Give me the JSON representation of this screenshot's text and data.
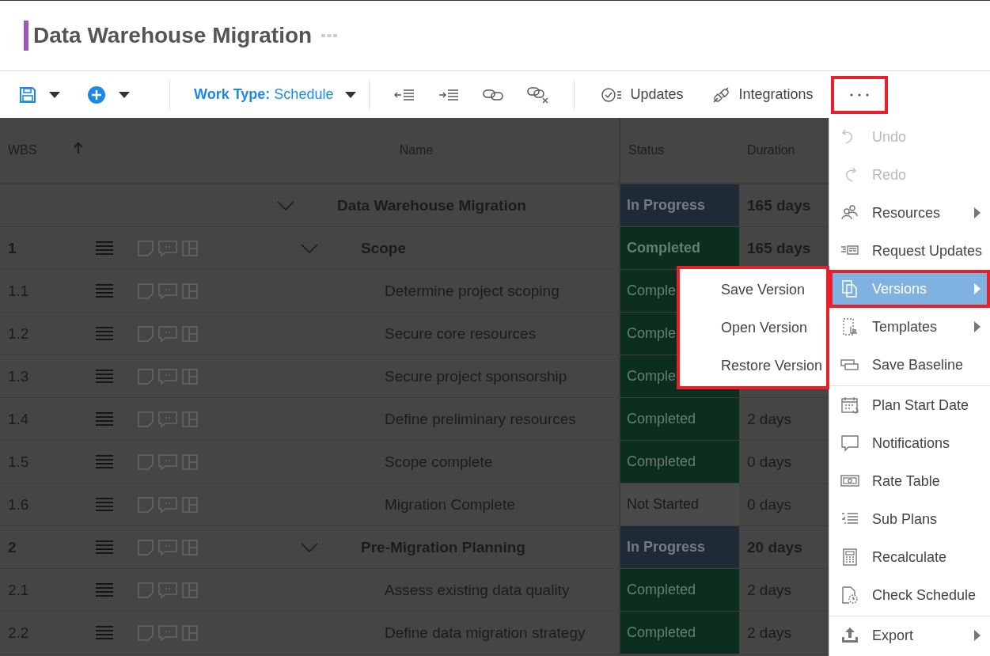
{
  "title": "Data Warehouse Migration",
  "toolbar": {
    "work_type_label": "Work Type:",
    "work_type_value": "Schedule",
    "buttons": [
      {
        "label": "Updates"
      },
      {
        "label": "Integrations"
      }
    ],
    "more_button": {
      "highlighted": true
    }
  },
  "columns": [
    "WBS",
    "Name",
    "Status",
    "Duration"
  ],
  "rows": [
    {
      "wbs": "",
      "name": "Data Warehouse Migration",
      "status": "In Progress",
      "color": "#1f2b34",
      "duration": "165 days",
      "expanded": true,
      "children": [
        {
          "wbs": "1",
          "name": "Scope",
          "status": "Completed",
          "color": "#0b2e1f",
          "duration": "165 days",
          "expanded": true,
          "children": [
            {
              "wbs": "1.1",
              "name": "Determine project scoping",
              "status": "Comple",
              "color": "#0b2e1f"
            },
            {
              "wbs": "1.2",
              "name": "Secure core resources",
              "status": "Comple",
              "color": "#0b2e1f"
            },
            {
              "wbs": "1.3",
              "name": "Secure project sponsorship",
              "status": "Comple",
              "color": "#0b2e1f"
            },
            {
              "wbs": "1.4",
              "name": "Define preliminary resources",
              "status": "Completed",
              "color": "#0b2e1f",
              "duration": "2 days"
            },
            {
              "wbs": "1.5",
              "name": "Scope complete",
              "status": "Completed",
              "color": "#0b2e1f",
              "duration": "0 days"
            },
            {
              "wbs": "1.6",
              "name": "Migration Complete",
              "status": "Not Started",
              "color": "#4a4a4a",
              "duration": "0 days"
            }
          ]
        },
        {
          "wbs": "2",
          "name": "Pre-Migration Planning",
          "status": "In Progress",
          "color": "#1f2b34",
          "duration": "20 days",
          "expanded": true,
          "children": [
            {
              "wbs": "2.1",
              "name": "Assess existing data quality",
              "status": "Completed",
              "color": "#0b2e1f",
              "duration": "2 days"
            },
            {
              "wbs": "2.2",
              "name": "Define data migration strategy",
              "status": "Completed",
              "color": "#0b2e1f",
              "duration": "2 days"
            }
          ]
        }
      ]
    }
  ],
  "menu": {
    "groups": [
      [
        {
          "label": "Undo",
          "disabled": true,
          "has_submenu": false,
          "selected": false,
          "highlighted": false
        },
        {
          "label": "Redo",
          "disabled": true,
          "has_submenu": false,
          "selected": false,
          "highlighted": false
        },
        {
          "label": "Resources",
          "disabled": false,
          "has_submenu": true,
          "selected": false,
          "highlighted": false
        },
        {
          "label": "Request Updates",
          "disabled": false,
          "has_submenu": false,
          "selected": false,
          "highlighted": false
        },
        {
          "label": "Versions",
          "disabled": false,
          "has_submenu": true,
          "selected": true,
          "highlighted": true
        },
        {
          "label": "Templates",
          "disabled": false,
          "has_submenu": true,
          "selected": false,
          "highlighted": false
        },
        {
          "label": "Save Baseline",
          "disabled": false,
          "has_submenu": false,
          "selected": false,
          "highlighted": false
        }
      ],
      [
        {
          "label": "Plan Start Date",
          "disabled": false,
          "has_submenu": false,
          "selected": false,
          "highlighted": false
        },
        {
          "label": "Notifications",
          "disabled": false,
          "has_submenu": false,
          "selected": false,
          "highlighted": false
        },
        {
          "label": "Rate Table",
          "disabled": false,
          "has_submenu": false,
          "selected": false,
          "highlighted": false
        },
        {
          "label": "Sub Plans",
          "disabled": false,
          "has_submenu": false,
          "selected": false,
          "highlighted": false
        },
        {
          "label": "Recalculate",
          "disabled": false,
          "has_submenu": false,
          "selected": false,
          "highlighted": false
        },
        {
          "label": "Check Schedule",
          "disabled": false,
          "has_submenu": false,
          "selected": false,
          "highlighted": false
        }
      ],
      [
        {
          "label": "Export",
          "disabled": false,
          "has_submenu": true,
          "selected": false,
          "highlighted": false
        }
      ]
    ]
  },
  "submenu": {
    "highlighted": true,
    "items": [
      {
        "label": "Save Version"
      },
      {
        "label": "Open Version"
      },
      {
        "label": "Restore Version"
      }
    ]
  }
}
